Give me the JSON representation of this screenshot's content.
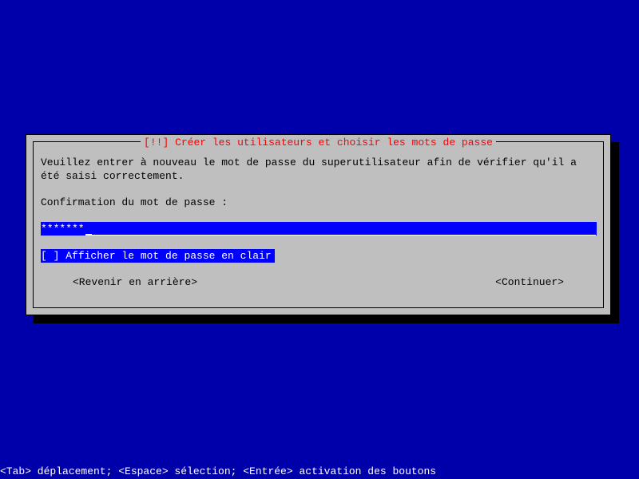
{
  "dialog": {
    "title_marker": "[!!]",
    "title_text": "Créer les utilisateurs et choisir les mots de passe",
    "instruction": "Veuillez entrer à nouveau le mot de passe du superutilisateur afin de vérifier qu'il a été saisi correctement.",
    "prompt": "Confirmation du mot de passe :",
    "password_value": "*******",
    "checkbox": {
      "state": "[ ]",
      "label": "Afficher le mot de passe en clair"
    },
    "buttons": {
      "back": "<Revenir en arrière>",
      "continue": "<Continuer>"
    }
  },
  "statusbar": "<Tab> déplacement; <Espace> sélection; <Entrée> activation des boutons"
}
